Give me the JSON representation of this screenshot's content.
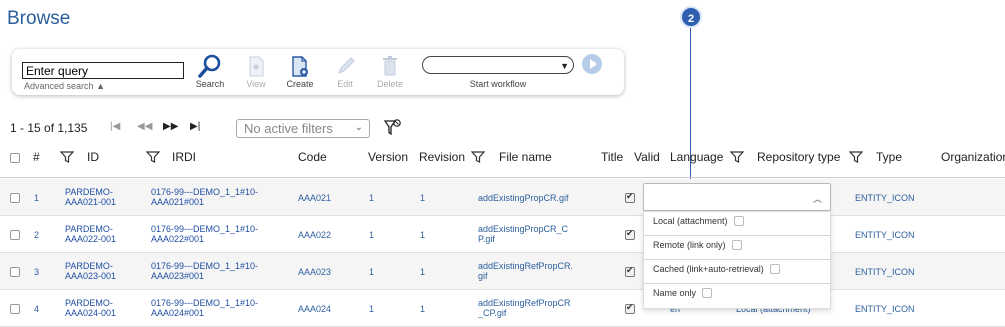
{
  "page": {
    "title": "Browse"
  },
  "toolbar": {
    "query_placeholder": "Enter query",
    "advanced_search": "Advanced search",
    "search": "Search",
    "view": "View",
    "create": "Create",
    "edit": "Edit",
    "delete": "Delete",
    "workflow_value": "",
    "start_workflow": "Start workflow"
  },
  "callout": {
    "number": "2"
  },
  "pager": {
    "range": "1 - 15 of 1,135",
    "filter_placeholder": "No active filters"
  },
  "columns": [
    "#",
    "ID",
    "IRDI",
    "Code",
    "Version",
    "Revision",
    "File name",
    "Title",
    "Valid",
    "Language",
    "Repository type",
    "Type",
    "Organization"
  ],
  "rows": [
    {
      "num": "1",
      "id": "PARDEMO-\nAAA021-001",
      "irdi": "0176-99---DEMO_1_1#10-\nAAA021#001",
      "code": "AAA021",
      "version": "1",
      "revision": "1",
      "file": "addExistingPropCR.gif",
      "valid": true,
      "language": "",
      "repo": "",
      "type": "ENTITY_ICON"
    },
    {
      "num": "2",
      "id": "PARDEMO-\nAAA022-001",
      "irdi": "0176-99---DEMO_1_1#10-\nAAA022#001",
      "code": "AAA022",
      "version": "1",
      "revision": "1",
      "file": "addExistingPropCR_C\nP.gif",
      "valid": true,
      "language": "",
      "repo": "",
      "type": "ENTITY_ICON"
    },
    {
      "num": "3",
      "id": "PARDEMO-\nAAA023-001",
      "irdi": "0176-99---DEMO_1_1#10-\nAAA023#001",
      "code": "AAA023",
      "version": "1",
      "revision": "1",
      "file": "addExistingRefPropCR.\ngif",
      "valid": true,
      "language": "",
      "repo": "",
      "type": "ENTITY_ICON"
    },
    {
      "num": "4",
      "id": "PARDEMO-\nAAA024-001",
      "irdi": "0176-99---DEMO_1_1#10-\nAAA024#001",
      "code": "AAA024",
      "version": "1",
      "revision": "1",
      "file": "addExistingRefPropCR\n_CP.gif",
      "valid": true,
      "language": "en",
      "repo": "Local (attachment)",
      "type": "ENTITY_ICON"
    }
  ],
  "language_filter": {
    "value": "",
    "options": [
      "Local (attachment)",
      "Remote (link only)",
      "Cached (link+auto-retrieval)",
      "Name only"
    ]
  }
}
